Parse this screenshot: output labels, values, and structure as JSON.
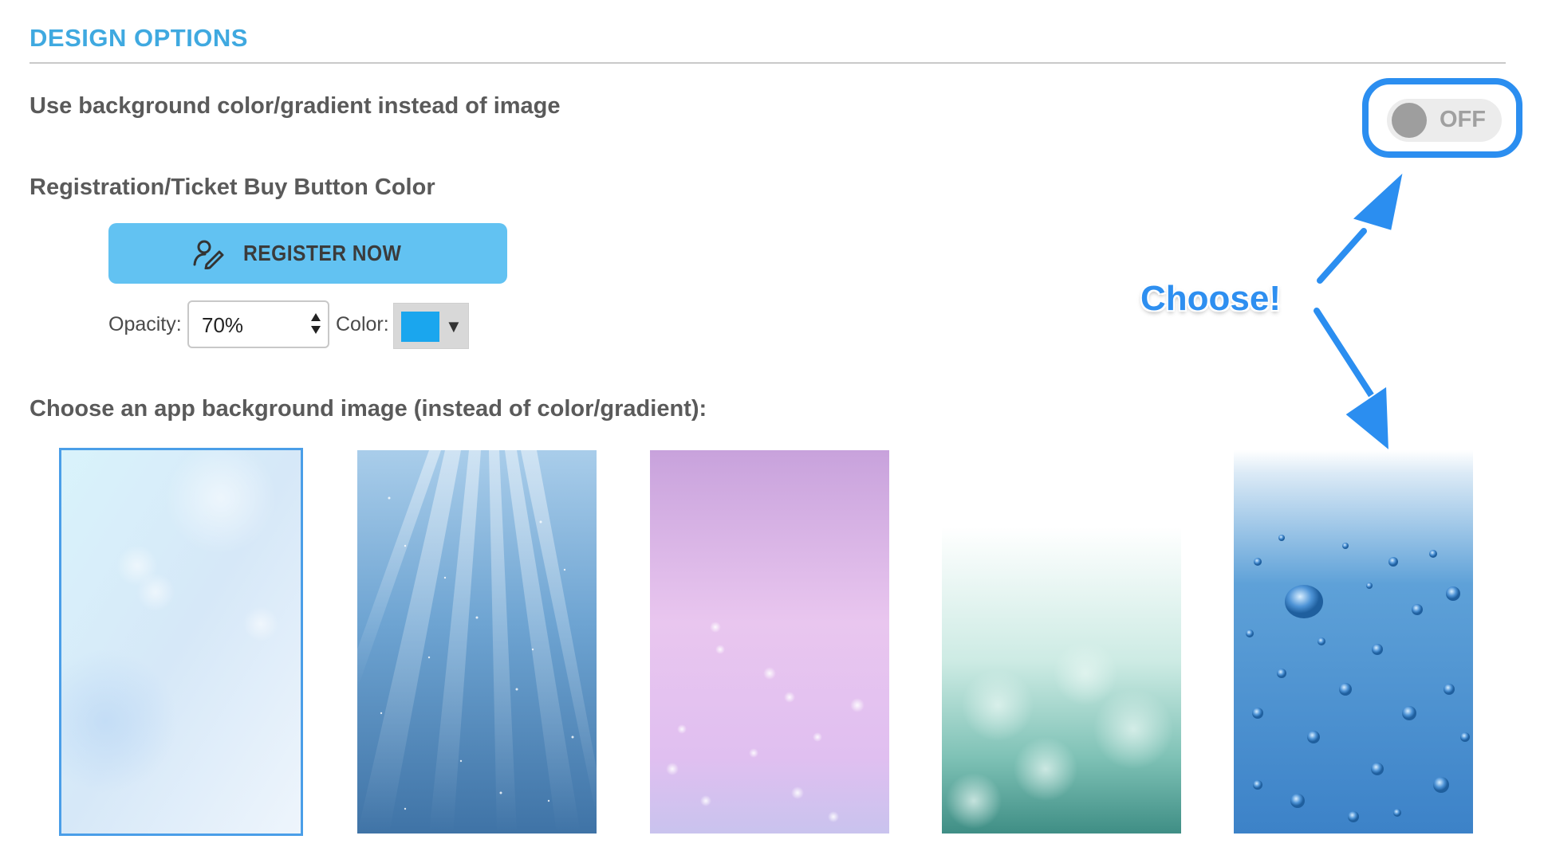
{
  "section": {
    "title": "DESIGN OPTIONS"
  },
  "options": {
    "gradient_label": "Use background color/gradient instead of image",
    "toggle_state": "OFF",
    "button_color_label": "Registration/Ticket Buy Button Color",
    "register_button_label": "REGISTER NOW",
    "opacity_label": "Opacity:",
    "opacity_value": "70%",
    "color_label": "Color:",
    "color_value": "#1aa6ee",
    "background_image_label": "Choose an app background image (instead of color/gradient):"
  },
  "background_images": [
    {
      "name": "soft-light-blue-bokeh",
      "selected": true
    },
    {
      "name": "blue-light-rays",
      "selected": false
    },
    {
      "name": "purple-pink-sparkles",
      "selected": false
    },
    {
      "name": "white-teal-bokeh",
      "selected": false
    },
    {
      "name": "blue-water-droplets",
      "selected": false
    }
  ],
  "annotation": {
    "text": "Choose!"
  },
  "colors": {
    "accent": "#3fa9e0",
    "annotation_blue": "#2b8ef0",
    "register_button": "#62c2f2"
  },
  "icons": {
    "register": "user-edit-icon",
    "select": "updown-arrows-icon",
    "dropdown": "caret-down-icon"
  }
}
